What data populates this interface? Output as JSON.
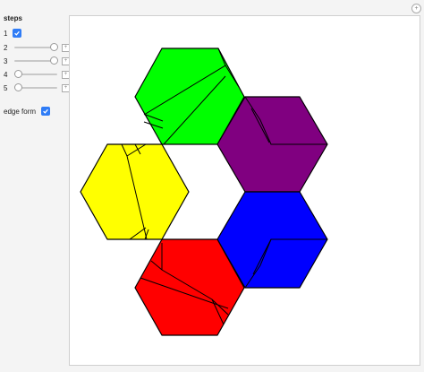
{
  "controls": {
    "steps_title": "steps",
    "step1": {
      "label": "1",
      "checked": true
    },
    "sliders": [
      {
        "label": "2",
        "value": 1.0
      },
      {
        "label": "3",
        "value": 1.0
      },
      {
        "label": "4",
        "value": 0.0
      },
      {
        "label": "5",
        "value": 0.0
      }
    ],
    "edge_form": {
      "label": "edge form",
      "checked": true
    }
  },
  "colors": {
    "accent": "#2f7cf6",
    "hexagons": [
      "#00ff00",
      "#800080",
      "#0000ff",
      "#ff0000",
      "#ffff00"
    ]
  },
  "hexagons": [
    {
      "name": "green-hexagon",
      "color": "#00ff00"
    },
    {
      "name": "purple-hexagon",
      "color": "#800080"
    },
    {
      "name": "blue-hexagon",
      "color": "#0000ff"
    },
    {
      "name": "red-hexagon",
      "color": "#ff0000"
    },
    {
      "name": "yellow-hexagon",
      "color": "#ffff00"
    }
  ]
}
